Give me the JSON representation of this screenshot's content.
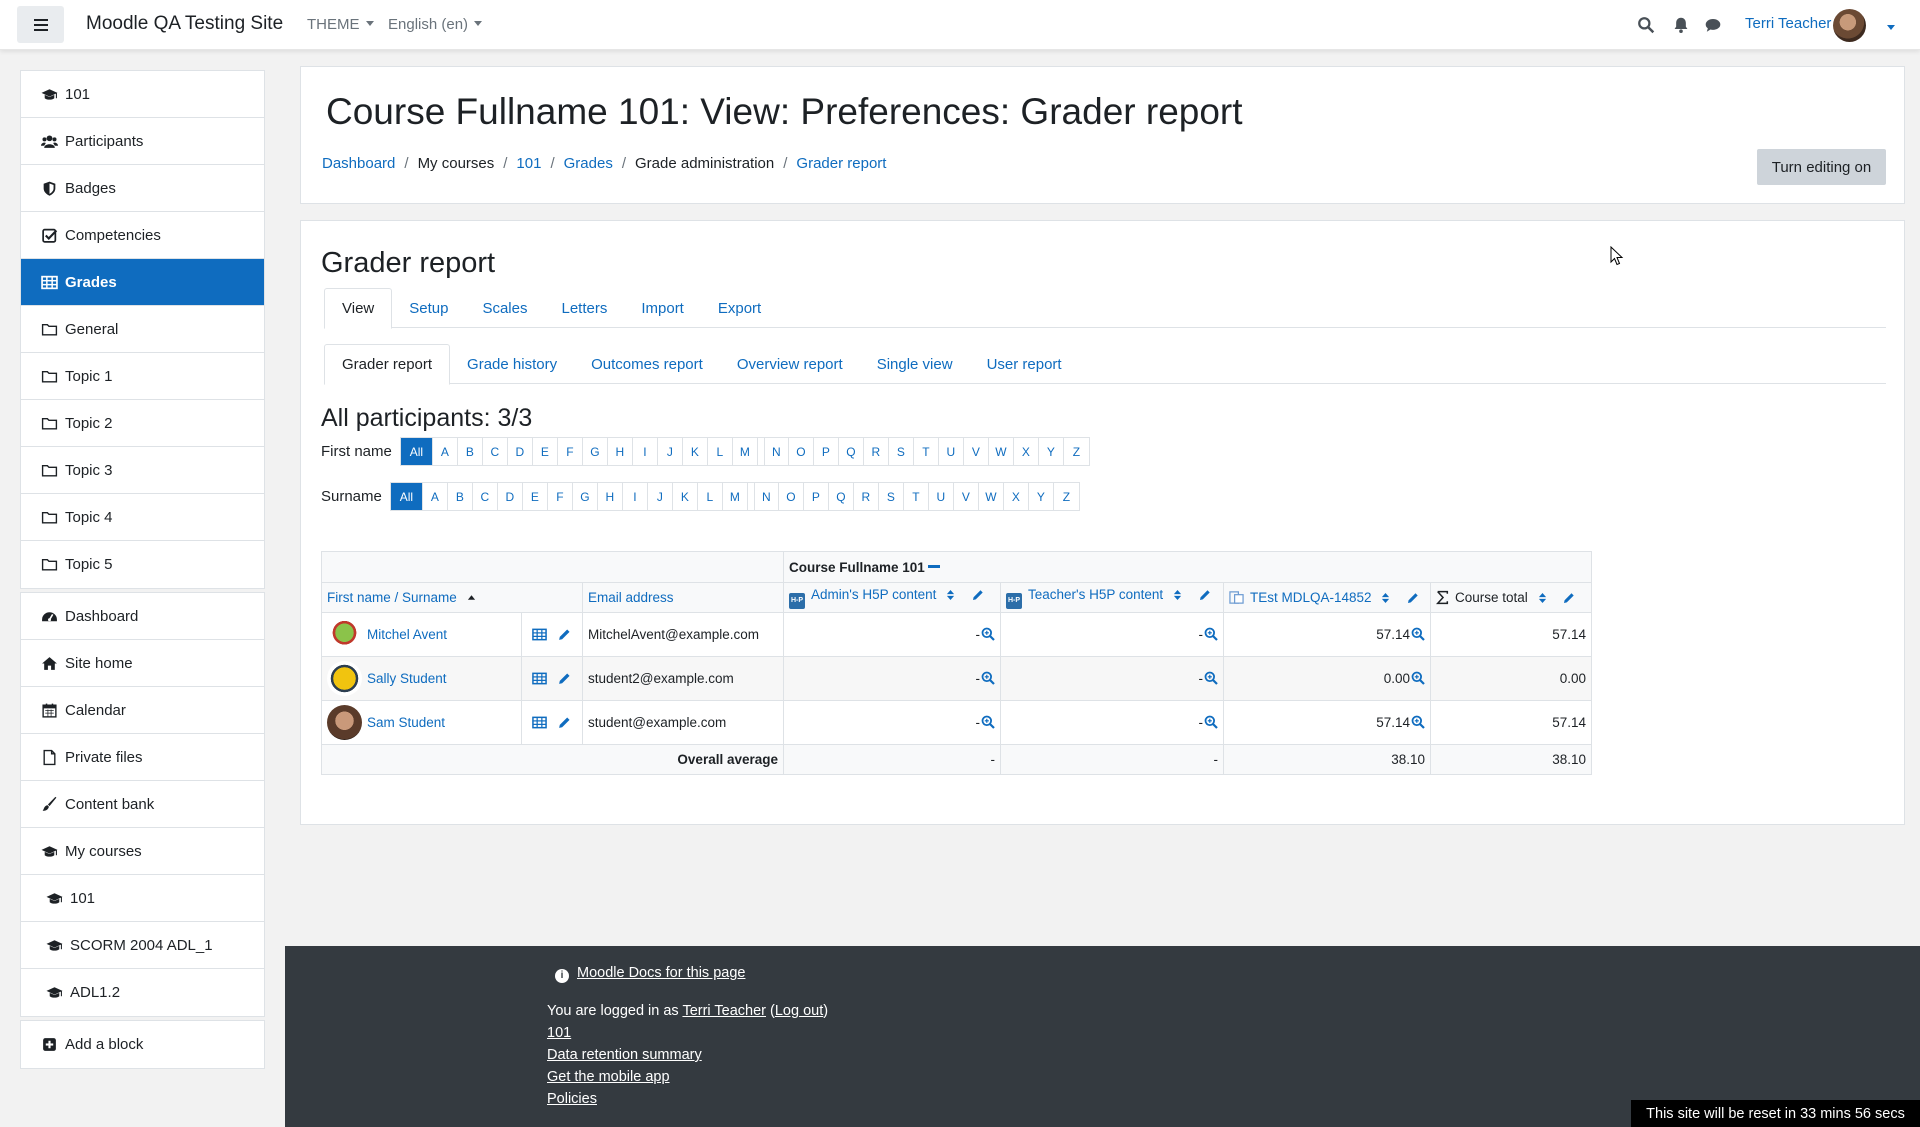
{
  "navbar": {
    "site_name": "Moodle QA Testing Site",
    "theme_label": "THEME",
    "language_label": "English (en)",
    "user_name": "Terri Teacher"
  },
  "sidebar": {
    "course_items": [
      {
        "label": "101",
        "icon": "graduation-cap-icon"
      },
      {
        "label": "Participants",
        "icon": "users-icon"
      },
      {
        "label": "Badges",
        "icon": "shield-icon"
      },
      {
        "label": "Competencies",
        "icon": "checkbox-icon"
      },
      {
        "label": "Grades",
        "icon": "table-icon",
        "active": true
      },
      {
        "label": "General",
        "icon": "folder-icon"
      },
      {
        "label": "Topic 1",
        "icon": "folder-icon"
      },
      {
        "label": "Topic 2",
        "icon": "folder-icon"
      },
      {
        "label": "Topic 3",
        "icon": "folder-icon"
      },
      {
        "label": "Topic 4",
        "icon": "folder-icon"
      },
      {
        "label": "Topic 5",
        "icon": "folder-icon"
      }
    ],
    "site_items": [
      {
        "label": "Dashboard",
        "icon": "dashboard-icon"
      },
      {
        "label": "Site home",
        "icon": "home-icon"
      },
      {
        "label": "Calendar",
        "icon": "calendar-icon"
      },
      {
        "label": "Private files",
        "icon": "file-icon"
      },
      {
        "label": "Content bank",
        "icon": "brush-icon"
      },
      {
        "label": "My courses",
        "icon": "graduation-cap-icon"
      },
      {
        "label": "101",
        "icon": "graduation-cap-icon",
        "indent": true
      },
      {
        "label": "SCORM 2004 ADL_1",
        "icon": "graduation-cap-icon",
        "indent": true
      },
      {
        "label": "ADL1.2",
        "icon": "graduation-cap-icon",
        "indent": true
      }
    ],
    "add_block": "Add a block"
  },
  "header": {
    "title": "Course Fullname 101: View: Preferences: Grader report",
    "breadcrumb": [
      "Dashboard",
      "My courses",
      "101",
      "Grades",
      "Grade administration",
      "Grader report"
    ],
    "edit_button": "Turn editing on"
  },
  "main": {
    "title": "Grader report",
    "tabs": [
      "View",
      "Setup",
      "Scales",
      "Letters",
      "Import",
      "Export"
    ],
    "subtabs": [
      "Grader report",
      "Grade history",
      "Outcomes report",
      "Overview report",
      "Single view",
      "User report"
    ],
    "participants": "All participants: 3/3",
    "first_name_label": "First name",
    "surname_label": "Surname",
    "all_label": "All",
    "letters_a": [
      "A",
      "B",
      "C",
      "D",
      "E",
      "F",
      "G",
      "H",
      "I",
      "J",
      "K",
      "L",
      "M"
    ],
    "letters_b": [
      "N",
      "O",
      "P",
      "Q",
      "R",
      "S",
      "T",
      "U",
      "V",
      "W",
      "X",
      "Y",
      "Z"
    ]
  },
  "grades": {
    "category": "Course Fullname 101",
    "headers": {
      "name": "First name / Surname",
      "email": "Email address",
      "col1": "Admin's H5P content",
      "col2": "Teacher's H5P content",
      "col3": "TEst MDLQA-14852",
      "total": "Course total"
    },
    "h5p_badge": "H-P",
    "rows": [
      {
        "name": "Mitchel Avent",
        "email": "MitchelAvent@example.com",
        "g1": "-",
        "g2": "-",
        "g3": "57.14",
        "total": "57.14"
      },
      {
        "name": "Sally Student",
        "email": "student2@example.com",
        "g1": "-",
        "g2": "-",
        "g3": "0.00",
        "total": "0.00"
      },
      {
        "name": "Sam Student",
        "email": "student@example.com",
        "g1": "-",
        "g2": "-",
        "g3": "57.14",
        "total": "57.14"
      }
    ],
    "average": {
      "label": "Overall average",
      "g1": "-",
      "g2": "-",
      "g3": "38.10",
      "total": "38.10"
    }
  },
  "footer": {
    "docs_link": "Moodle Docs for this page",
    "logged_in_prefix": "You are logged in as ",
    "logged_in_user": "Terri Teacher",
    "logout_open": " (",
    "logout": "Log out",
    "logout_close": ")",
    "course_link": "101",
    "data_retention": "Data retention summary",
    "mobile_app": "Get the mobile app",
    "policies": "Policies"
  },
  "reset_banner": "This site will be reset in 33 mins 56 secs",
  "colors": {
    "brand": "#0f6cbf",
    "footer": "#343a40"
  }
}
